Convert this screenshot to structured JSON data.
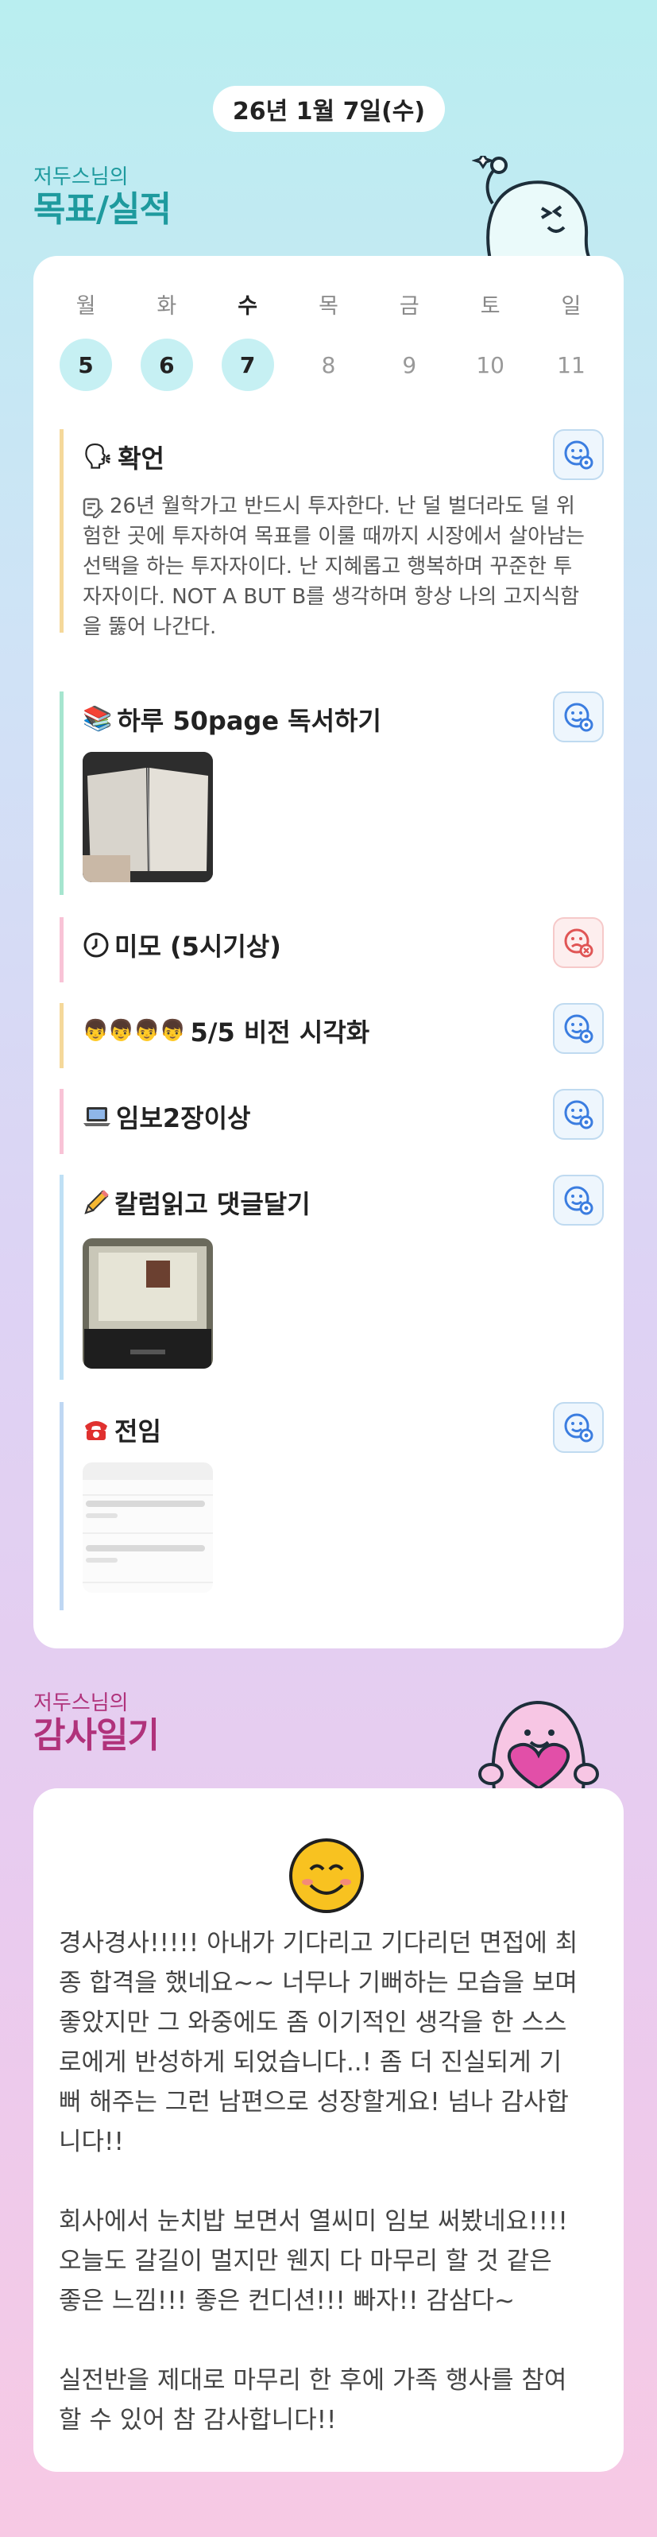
{
  "header": {
    "date": "26년 1월 7일(수)"
  },
  "goals_section": {
    "subtitle": "저두스님의",
    "title": "목표/실적"
  },
  "week": [
    {
      "dow": "월",
      "num": "5",
      "done": true
    },
    {
      "dow": "화",
      "num": "6",
      "done": true
    },
    {
      "dow": "수",
      "num": "7",
      "done": true,
      "today": true
    },
    {
      "dow": "목",
      "num": "8",
      "done": false
    },
    {
      "dow": "금",
      "num": "9",
      "done": false
    },
    {
      "dow": "토",
      "num": "10",
      "done": false
    },
    {
      "dow": "일",
      "num": "11",
      "done": false
    }
  ],
  "goals": [
    {
      "emoji": "🗣",
      "title": "확언",
      "bar_color": "#f5d89a",
      "status": "success",
      "desc": "26년 월학가고 반드시 투자한다. 난 덜 벌더라도 덜 위험한 곳에 투자하여 목표를 이룰 때까지 시장에서 살아남는 선택을 하는 투자자이다. 난 지혜롭고 행복하며 꾸준한 투자자이다. NOT A BUT B를 생각하며 항상 나의 고지식함을 뚫어 나간다."
    },
    {
      "emoji": "📚",
      "title": "하루 50page 독서하기",
      "bar_color": "#a6e5cf",
      "status": "success"
    },
    {
      "emoji": "🕓",
      "title": "미모 (5시기상)",
      "bar_color": "#f8c3d6",
      "status": "fail"
    },
    {
      "emoji": "👦👦👦👦",
      "title": "5/5 비전 시각화",
      "bar_color": "#f5d89a",
      "status": "success"
    },
    {
      "emoji": "💻",
      "title": "임보2장이상",
      "bar_color": "#f8c3d6",
      "status": "success"
    },
    {
      "emoji": "✏️",
      "title": "칼럼읽고 댓글달기",
      "bar_color": "#bfe0f5",
      "status": "success"
    },
    {
      "emoji": "☎️",
      "title": "전임",
      "bar_color": "#bfd7f3",
      "status": "success"
    }
  ],
  "gratitude_section": {
    "subtitle": "저두스님의",
    "title": "감사일기"
  },
  "gratitude": {
    "emoji": "😊",
    "paragraphs": [
      [
        "경사경사!!!!! 아내가 기다리고 기다리던 면접에 최",
        "종 합격을 했네요~~ 너무나 기뻐하는 모습을 보며",
        "좋았지만 그 와중에도 좀 이기적인 생각을 한 스스",
        "로에게 반성하게 되었습니다..! 좀 더 진실되게 기",
        "뻐 해주는 그런 남편으로 성장할게요! 넘나 감사합",
        "니다!!"
      ],
      [
        "회사에서 눈치밥 보면서 열씨미 임보 써봤네요!!!!",
        "오늘도 갈길이 멀지만 웬지 다 마무리 할 것 같은",
        "좋은 느낌!!! 좋은 컨디션!!! 빠자!! 감삼다~"
      ],
      [
        "실전반을 제대로 마무리 한 후에 가족 행사를 참여",
        "할 수 있어 참 감사합니다!!"
      ]
    ]
  },
  "colors": {
    "success_icon": "#3b7de0",
    "fail_icon": "#e05555",
    "teal": "#1e9a9e",
    "magenta": "#b0327b"
  }
}
